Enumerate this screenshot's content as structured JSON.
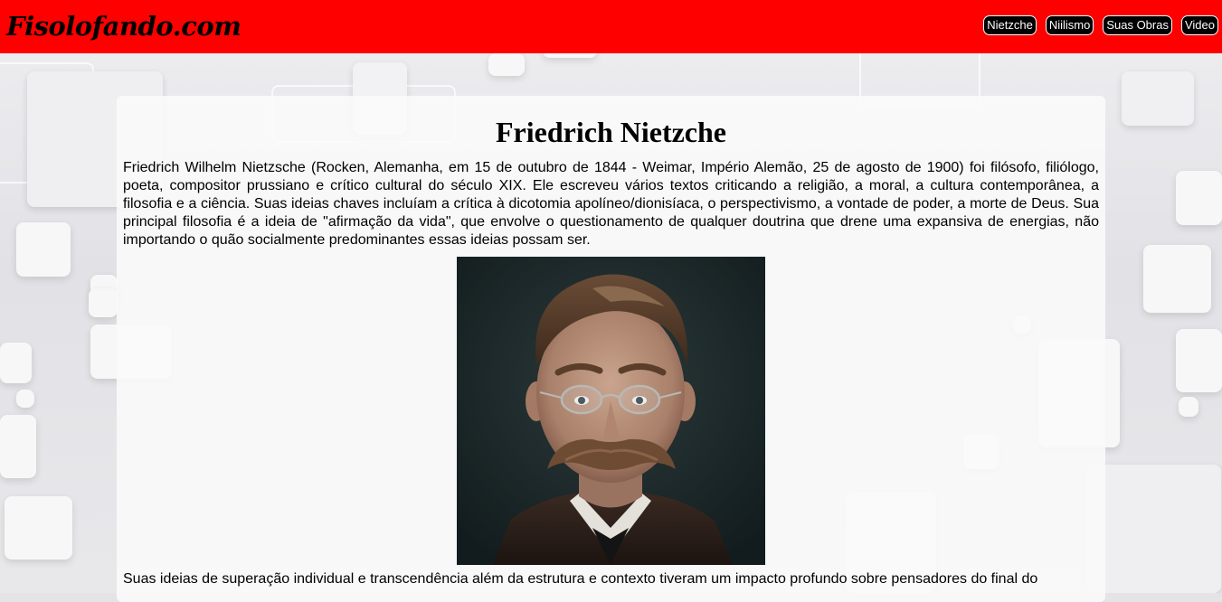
{
  "header": {
    "logo": "Fisolofando.com",
    "nav": [
      "Nietzche",
      "Niilismo",
      "Suas Obras",
      "Video"
    ]
  },
  "main": {
    "title": "Friedrich Nietzche",
    "paragraph1": "Friedrich Wilhelm Nietzsche (Rocken, Alemanha, em 15 de outubro de 1844 - Weimar, Império Alemão, 25 de agosto de 1900) foi filósofo, filiólogo, poeta, compositor prussiano e crítico cultural do século XIX. Ele escreveu vários textos criticando a religião, a moral, a cultura contemporânea, a filosofia e a ciência. Suas ideias chaves incluíam a crítica à dicotomia apolíneo/dionisíaca, o perspectivismo, a vontade de poder, a morte de Deus. Sua principal filosofia é a ideia de \"afirmação da vida\", que envolve o questionamento de qualquer doutrina que drene uma expansiva de energias, não importando o quão socialmente predominantes essas ideias possam ser.",
    "paragraph2": "Suas ideias de superação individual e transcendência além da estrutura e contexto tiveram um impacto profundo sobre pensadores do final do"
  },
  "colors": {
    "header_bg": "#ff0000",
    "nav_bg": "#000000",
    "nav_text": "#ffffff"
  }
}
